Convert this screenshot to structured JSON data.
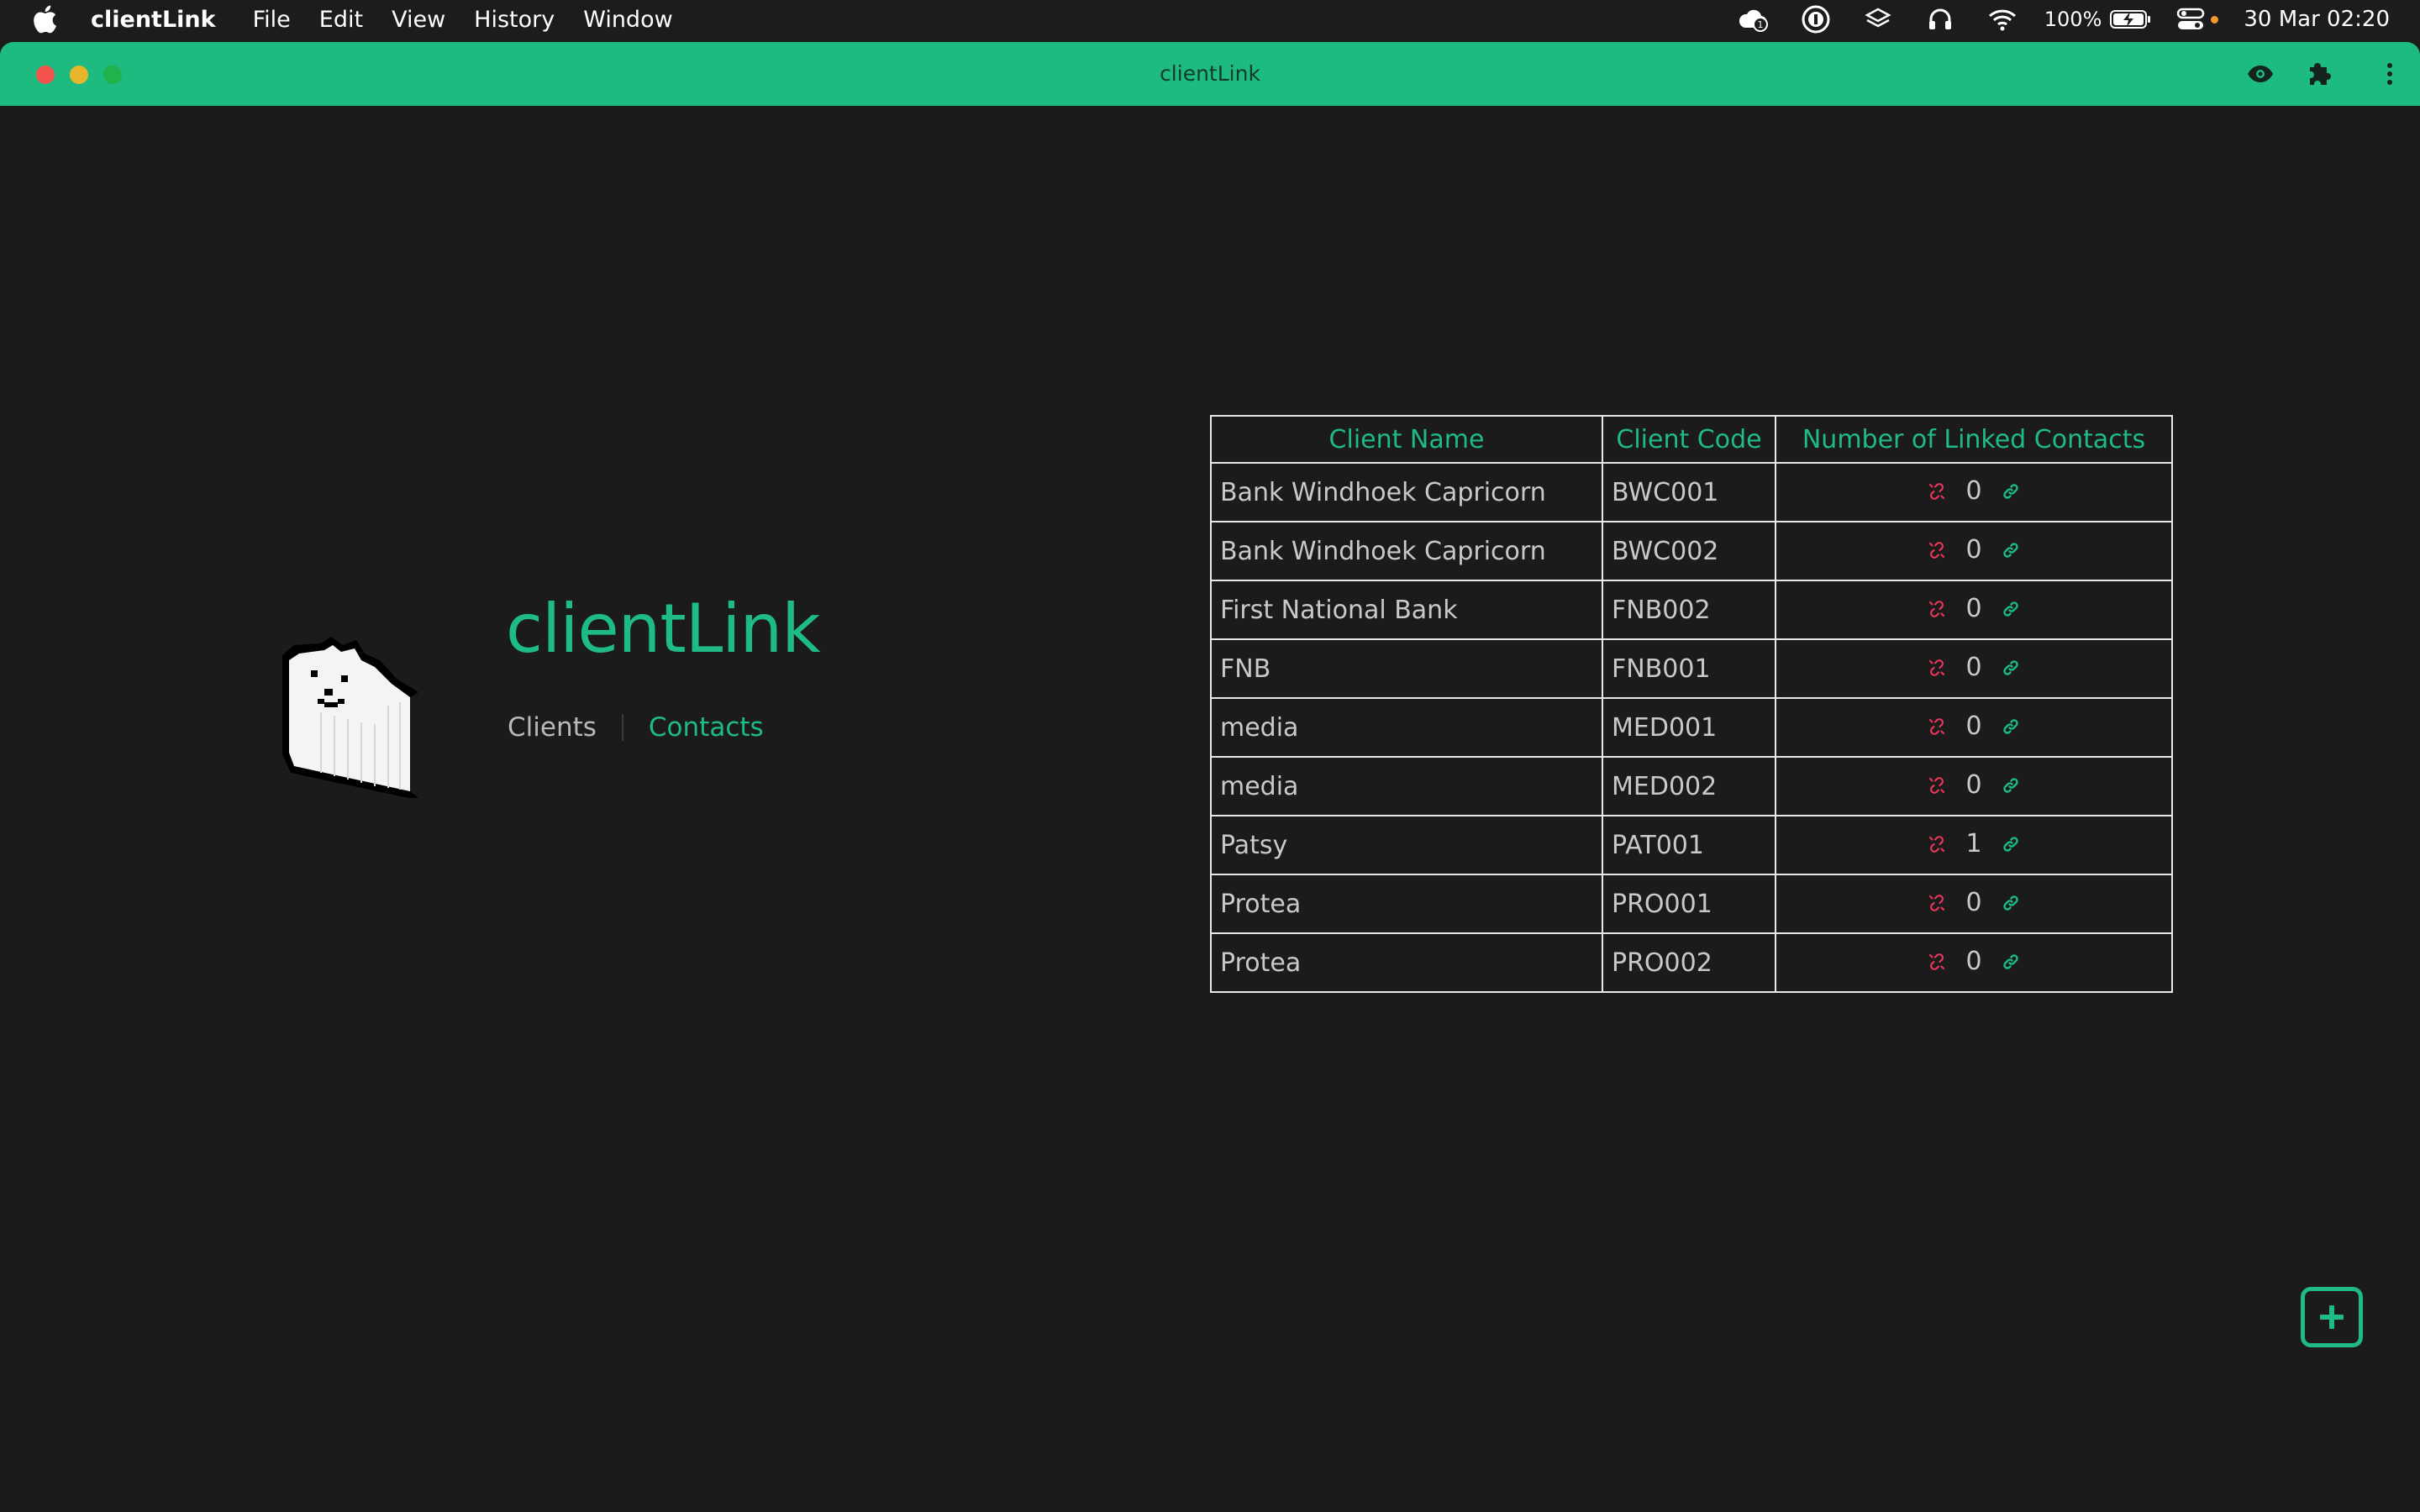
{
  "menubar": {
    "app_name": "clientLink",
    "items": [
      "File",
      "Edit",
      "View",
      "History",
      "Window"
    ],
    "battery_percent": "100%",
    "clock": "30 Mar  02:20"
  },
  "window": {
    "title": "clientLink"
  },
  "brand": {
    "title": "clientLink"
  },
  "nav": {
    "clients": "Clients",
    "contacts": "Contacts",
    "active": "Contacts"
  },
  "table": {
    "headers": [
      "Client Name",
      "Client Code",
      "Number of Linked Contacts"
    ],
    "rows": [
      {
        "name": "Bank Windhoek Capricorn",
        "code": "BWC001",
        "count": "0"
      },
      {
        "name": "Bank Windhoek Capricorn",
        "code": "BWC002",
        "count": "0"
      },
      {
        "name": "First National Bank",
        "code": "FNB002",
        "count": "0"
      },
      {
        "name": "FNB",
        "code": "FNB001",
        "count": "0"
      },
      {
        "name": "media",
        "code": "MED001",
        "count": "0"
      },
      {
        "name": "media",
        "code": "MED002",
        "count": "0"
      },
      {
        "name": "Patsy",
        "code": "PAT001",
        "count": "1"
      },
      {
        "name": "Protea",
        "code": "PRO001",
        "count": "0"
      },
      {
        "name": "Protea",
        "code": "PRO002",
        "count": "0"
      }
    ]
  },
  "colors": {
    "accent": "#1fbb84",
    "titlebar": "#1dbb80",
    "background": "#1b1b1b",
    "unlink": "#e8365d"
  },
  "icons": {
    "unlink": "unlink-icon",
    "link": "link-icon",
    "add": "add-square-icon"
  }
}
